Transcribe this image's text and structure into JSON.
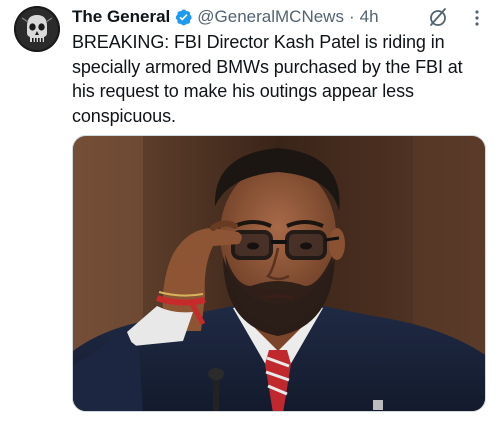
{
  "post": {
    "author": {
      "display_name": "The General",
      "handle": "@GeneralMCNews",
      "verified": true,
      "avatar_icon": "skull-avatar-icon"
    },
    "separator": "·",
    "timestamp": "4h",
    "text_lines": [
      "BREAKING: FBI Director Kash Patel is riding in",
      "specially armored BMWs purchased by the FBI at",
      "his request to make his outings appear less",
      "conspicuous."
    ],
    "actions": {
      "grok_icon": "grok-slash-circle-icon",
      "more_icon": "vertical-dots-icon"
    },
    "media": {
      "type": "photo",
      "subject": "man in glasses adjusting frames, dark suit, red tie"
    }
  },
  "colors": {
    "text_primary": "#0f1419",
    "text_secondary": "#536471",
    "verified_blue": "#1d9bf0",
    "border": "#cfd9de"
  }
}
